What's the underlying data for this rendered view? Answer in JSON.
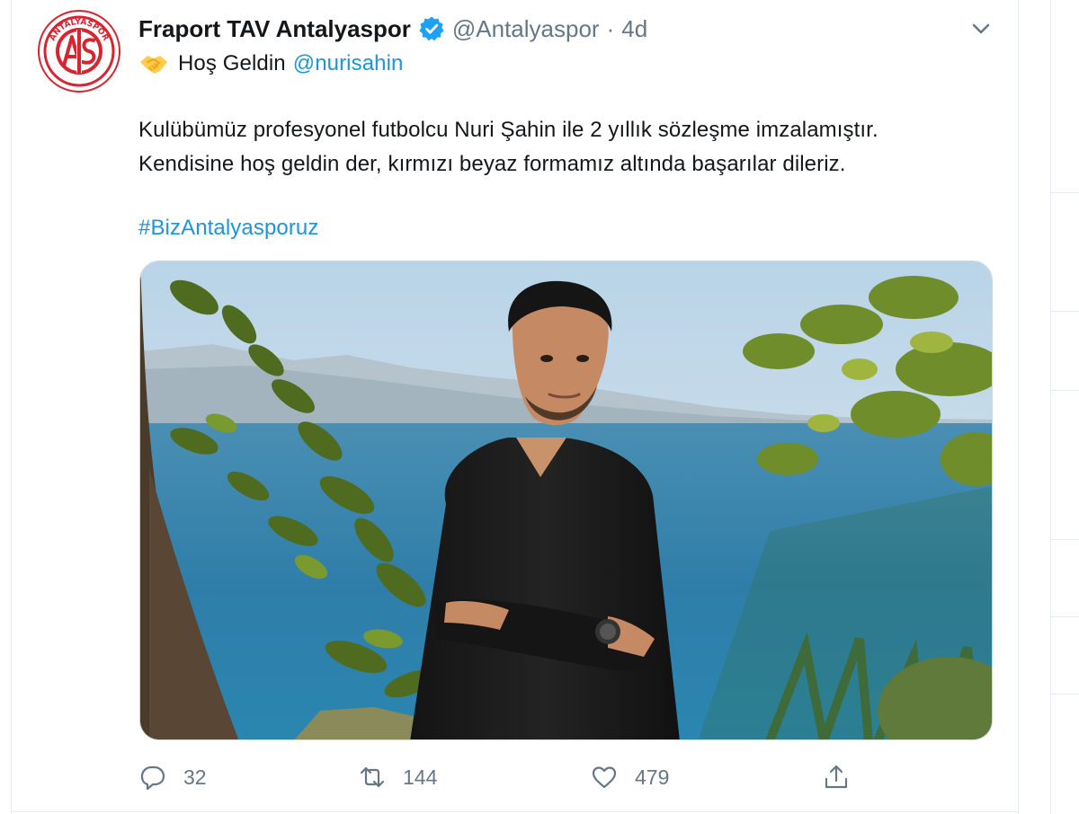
{
  "tweet": {
    "display_name": "Fraport TAV Antalyaspor",
    "handle": "@Antalyaspor",
    "separator": "·",
    "time": "4d",
    "greeting_text": "Hoş Geldin",
    "greeting_mention": "@nurisahin",
    "body_line_1": "Kulübümüz profesyonel futbolcu Nuri Şahin ile 2 yıllık sözleşme imzalamıştır.",
    "body_line_2": "Kendisine hoş geldin der, kırmızı beyaz formamız altında başarılar dileriz.",
    "hashtag": "#BizAntalyasporuz",
    "avatar_logo_text": "ANTALYASPOR",
    "emoji": "handshake-emoji"
  },
  "actions": {
    "reply_count": "32",
    "retweet_count": "144",
    "like_count": "479"
  },
  "icons": {
    "verified": "verified-badge-icon",
    "caret": "chevron-down-icon",
    "reply": "reply-icon",
    "retweet": "retweet-icon",
    "like": "heart-icon",
    "share": "share-icon"
  },
  "colors": {
    "link": "#1b95e0",
    "secondary_text": "#657786",
    "brand_red": "#d9232e",
    "verified_blue": "#1da1f2"
  }
}
